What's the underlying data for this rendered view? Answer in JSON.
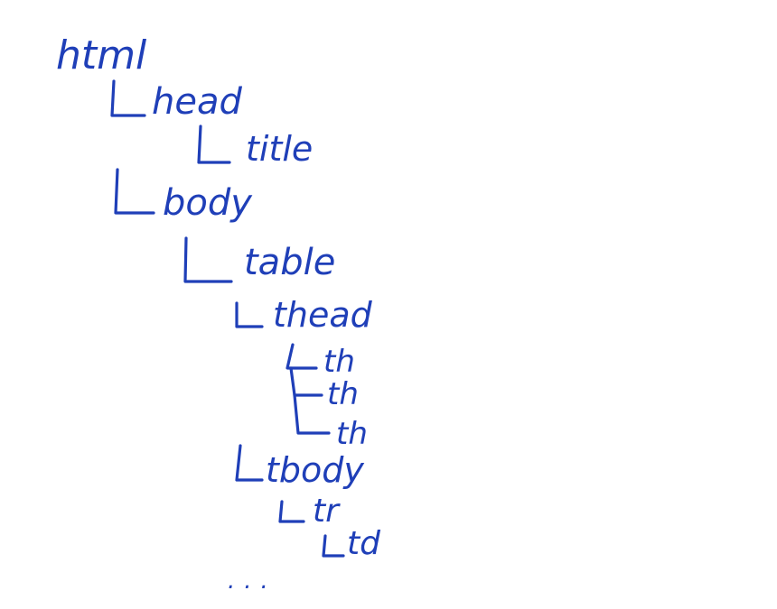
{
  "diagram": {
    "ink_color": "#1f3fb8",
    "nodes": [
      {
        "label": "html"
      },
      {
        "label": "head"
      },
      {
        "label": "title"
      },
      {
        "label": "body"
      },
      {
        "label": "table"
      },
      {
        "label": "thead"
      },
      {
        "label": "th"
      },
      {
        "label": "th"
      },
      {
        "label": "th"
      },
      {
        "label": "tbody"
      },
      {
        "label": "tr"
      },
      {
        "label": "td"
      }
    ],
    "ellipsis": "..."
  }
}
